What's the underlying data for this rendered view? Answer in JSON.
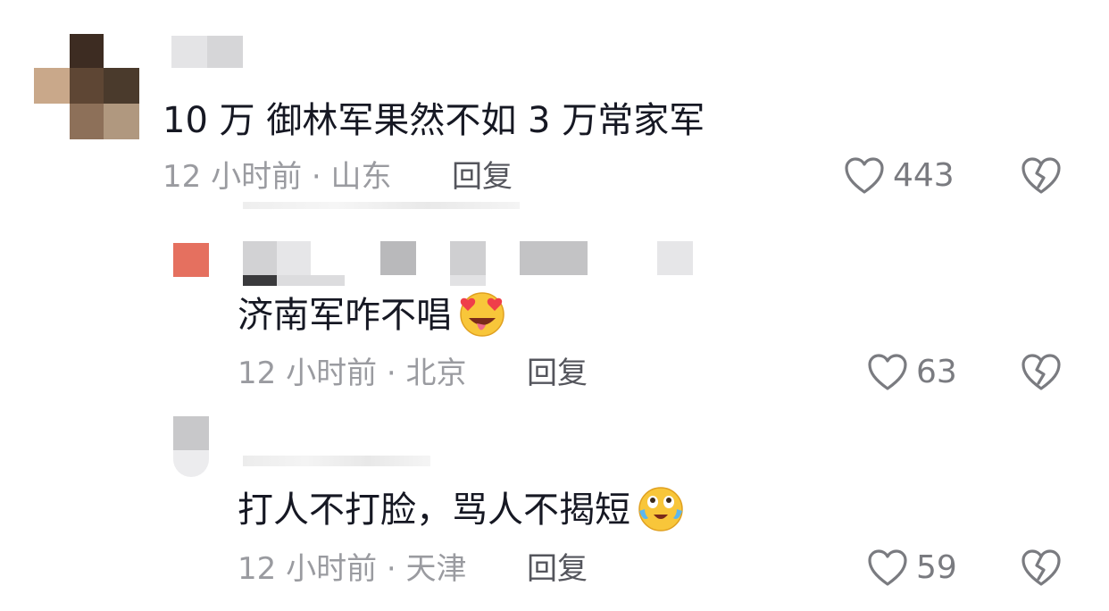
{
  "comments": [
    {
      "text": "10 万 御林军果然不如 3 万常家军",
      "time": "12 小时前",
      "separator": "·",
      "location": "山东",
      "reply_label": "回复",
      "likes": "443",
      "icons": {
        "like": "heart-outline-icon",
        "dislike": "broken-heart-icon"
      }
    },
    {
      "text": "济南军咋不唱",
      "emoji": "heart-eyes-tongue-emoji",
      "time": "12 小时前",
      "separator": "·",
      "location": "北京",
      "reply_label": "回复",
      "likes": "63",
      "icons": {
        "like": "heart-outline-icon",
        "dislike": "broken-heart-icon"
      }
    },
    {
      "text": "打人不打脸，骂人不揭短",
      "emoji": "laughing-crying-emoji",
      "time": "12 小时前",
      "separator": "·",
      "location": "天津",
      "reply_label": "回复",
      "likes": "59",
      "icons": {
        "like": "heart-outline-icon",
        "dislike": "broken-heart-icon"
      }
    }
  ],
  "colors": {
    "text_primary": "#161823",
    "text_meta": "#9a9ba0",
    "reply": "#54555c",
    "icon": "#7a7b80"
  }
}
